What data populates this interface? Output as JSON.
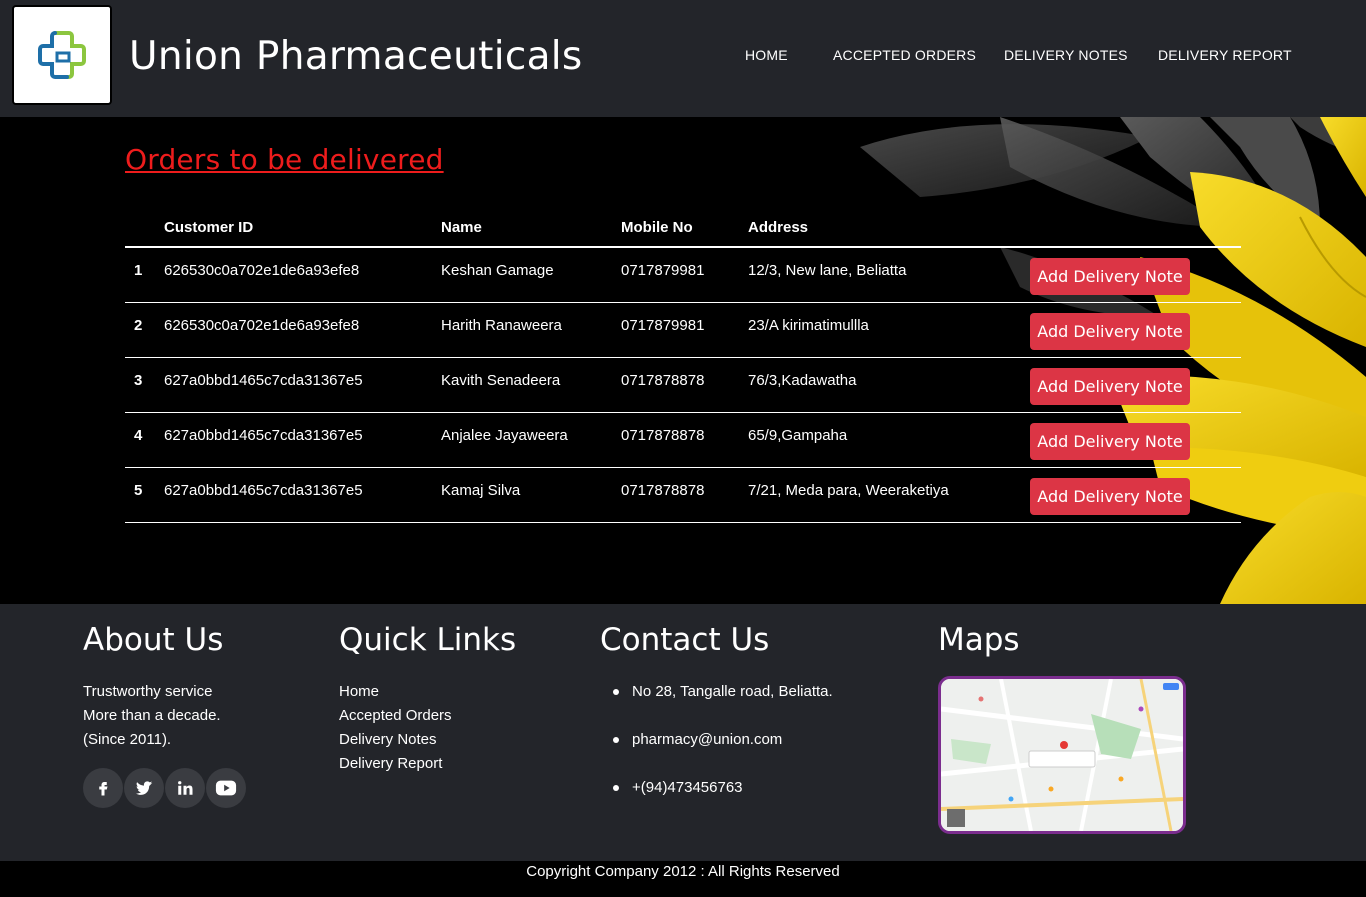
{
  "header": {
    "brand": "Union Pharmaceuticals",
    "nav": [
      "HOME",
      "ACCEPTED ORDERS",
      "DELIVERY NOTES",
      "DELIVERY REPORT"
    ]
  },
  "main": {
    "title": "Orders to be delivered",
    "columns": [
      "Customer ID",
      "Name",
      "Mobile No",
      "Address"
    ],
    "action_label": "Add Delivery Note",
    "rows": [
      {
        "num": "1",
        "id": "626530c0a702e1de6a93efe8",
        "name": "Keshan Gamage",
        "mobile": "0717879981",
        "address": "12/3, New lane, Beliatta"
      },
      {
        "num": "2",
        "id": "626530c0a702e1de6a93efe8",
        "name": "Harith Ranaweera",
        "mobile": "0717879981",
        "address": "23/A kirimatimullla"
      },
      {
        "num": "3",
        "id": "627a0bbd1465c7cda31367e5",
        "name": "Kavith Senadeera",
        "mobile": "0717878878",
        "address": "76/3,Kadawatha"
      },
      {
        "num": "4",
        "id": "627a0bbd1465c7cda31367e5",
        "name": "Anjalee Jayaweera",
        "mobile": "0717878878",
        "address": "65/9,Gampaha"
      },
      {
        "num": "5",
        "id": "627a0bbd1465c7cda31367e5",
        "name": "Kamaj Silva",
        "mobile": "0717878878",
        "address": "7/21, Meda para, Weeraketiya"
      }
    ]
  },
  "footer": {
    "about": {
      "heading": "About Us",
      "lines": [
        "Trustworthy service",
        "More than a decade.",
        "(Since 2011)."
      ]
    },
    "quick_links": {
      "heading": "Quick Links",
      "items": [
        "Home",
        "Accepted Orders",
        "Delivery Notes",
        "Delivery Report"
      ]
    },
    "contact": {
      "heading": "Contact Us",
      "items": [
        "No 28, Tangalle road, Beliatta.",
        "pharmacy@union.com",
        "+(94)473456763"
      ]
    },
    "maps": {
      "heading": "Maps"
    },
    "socials": [
      "facebook-icon",
      "twitter-icon",
      "linkedin-icon",
      "youtube-icon"
    ]
  },
  "copyright": "Copyright Company 2012 : All Rights Reserved",
  "colors": {
    "header_bg": "#23252a",
    "title_red": "#ee1c1c",
    "button_red": "#dc3545",
    "flower_yellow": "#f2d10c"
  }
}
